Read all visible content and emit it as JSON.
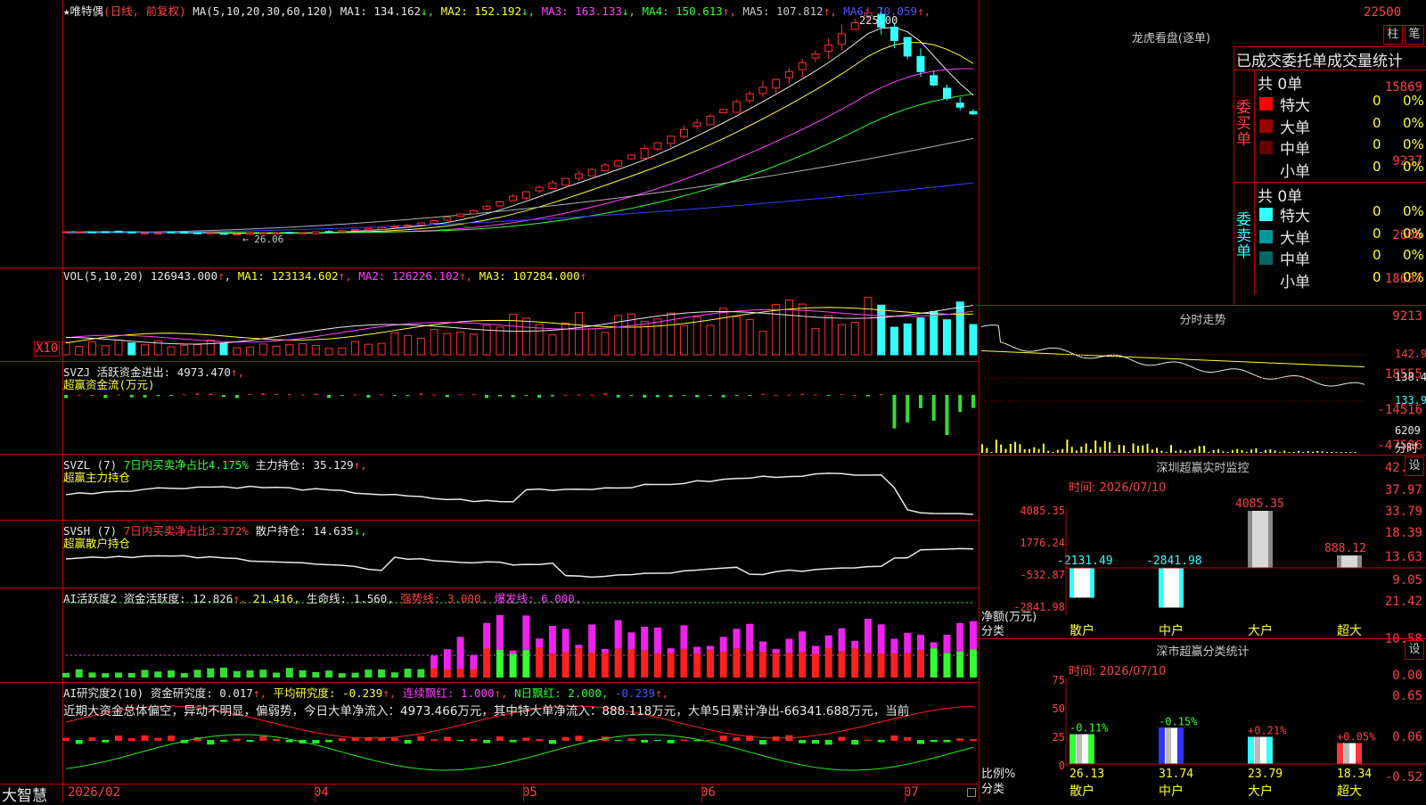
{
  "app": {
    "name": "大智慧"
  },
  "stock": {
    "star": "★",
    "name": "唯特偶",
    "period": "(日线, 前复权)"
  },
  "kline": {
    "ma_label": "MA(5,10,20,30,60,120)",
    "mas": [
      {
        "label": "MA1:",
        "value": "134.162",
        "arrow": "↓",
        "color": "#e8e8e8"
      },
      {
        "label": "MA2:",
        "value": "152.192",
        "arrow": "↓",
        "color": "#ffff33"
      },
      {
        "label": "MA3:",
        "value": "163.133",
        "arrow": "↓",
        "color": "#ff40ff"
      },
      {
        "label": "MA4:",
        "value": "150.613",
        "arrow": "↑",
        "color": "#33ff33"
      },
      {
        "label": "MA5:",
        "value": "107.812",
        "arrow": "↑",
        "color": "#c8c8c8"
      },
      {
        "label": "MA6:",
        "value": "70.059",
        "arrow": "↑",
        "color": "#5050ff"
      }
    ],
    "axis": [
      "22500",
      "15869",
      "9237",
      "2606"
    ],
    "high_marker": "225.00",
    "low_marker": "← 26.06"
  },
  "vol": {
    "label": "VOL(5,10,20)",
    "value": "126943.000",
    "arrow": "↑",
    "ma1": "MA1: 123134.602",
    "ma2": "MA2: 126226.102",
    "ma3": "MA3: 107284.000",
    "axis": [
      "18657",
      "9213"
    ],
    "unit": "X10"
  },
  "svzj": {
    "label": "SVZJ",
    "desc": "活跃资金进出:",
    "value": "4973.470",
    "arrow": "↑,",
    "sub": "超赢资金流(万元)",
    "axis": [
      "18555",
      "-14516",
      "-47586"
    ]
  },
  "svzl": {
    "label": "SVZL (7)",
    "desc1": "7日内买卖净占比4.175%",
    "desc2": "主力持仓:",
    "value": "35.129",
    "arrow": "↑,",
    "sub": "超赢主力持仓",
    "axis": [
      "42.15",
      "37.97",
      "33.79"
    ]
  },
  "svsh": {
    "label": "SVSH (7)",
    "desc1": "7日内买卖净占比3.372%",
    "desc2": "散户持仓:",
    "value": "14.635",
    "arrow": "↓,",
    "sub": "超赢散户持仓",
    "axis": [
      "18.39",
      "13.63",
      "9.05"
    ]
  },
  "ai1": {
    "label": "AI活跃度2",
    "a": "资金活跃度:",
    "av": "12.826",
    "aa": "↑,",
    "b": "21.416,",
    "c": "生命线:",
    "cv": "1.560,",
    "d": "强势线:",
    "dv": "3.000,",
    "e": "爆发线:",
    "ev": "6.000,",
    "axis": [
      "21.42",
      "10.58",
      "0.00"
    ]
  },
  "ai2": {
    "label": "AI研究度2(10)",
    "a": "资金研究度:",
    "av": "0.017",
    "aa": "↑,",
    "b": "平均研究度:",
    "bv": "-0.239",
    "ba": "↑,",
    "c": "连续飘红:",
    "cv": "1.000",
    "ca": "↑,",
    "d": "N日飘红:",
    "dv": "2.000,",
    "e": "-0.239",
    "ea": "↑,",
    "comment": "近期大资金总体偏空，异动不明显，偏弱势，今日大单净流入：4973.466万元，其中特大单净流入：888.118万元，大单5日累计净出-66341.688万元，当前",
    "axis": [
      "0.65",
      "0.06",
      "-0.52"
    ]
  },
  "xaxis": [
    "2026/02",
    "04",
    "05",
    "06",
    "07"
  ],
  "lhb": {
    "title": "龙虎看盘(逐单)",
    "btn1": "柱",
    "btn2": "笔",
    "subtitle": "已成交委托单成交量统计",
    "buy": {
      "side": "委买单",
      "total": "共 0单",
      "rows": [
        {
          "name": "特大",
          "v": "0",
          "p": "0%",
          "color": "#ff0000"
        },
        {
          "name": "大单",
          "v": "0",
          "p": "0%",
          "color": "#990000"
        },
        {
          "name": "中单",
          "v": "0",
          "p": "0%",
          "color": "#660000"
        },
        {
          "name": "小单",
          "v": "0",
          "p": "0%",
          "color": "#000000"
        }
      ]
    },
    "sell": {
      "side": "委卖单",
      "total": "共 0单",
      "rows": [
        {
          "name": "特大",
          "v": "0",
          "p": "0%",
          "color": "#33ffff"
        },
        {
          "name": "大单",
          "v": "0",
          "p": "0%",
          "color": "#009999"
        },
        {
          "name": "中单",
          "v": "0",
          "p": "0%",
          "color": "#006666"
        },
        {
          "name": "小单",
          "v": "0",
          "p": "0%",
          "color": "#000000"
        }
      ]
    }
  },
  "fenshi": {
    "title": "分时走势",
    "axis": [
      "142.9",
      "138.4",
      "133.9"
    ],
    "vol": "6209",
    "unit": "分时"
  },
  "monitor": {
    "title": "深圳超赢实时监控",
    "btn": "设",
    "time": "时间: 2026/07/10",
    "axis": [
      "4085.35",
      "1776.24",
      "-532.87",
      "-2841.98"
    ],
    "ylabel1": "净额(万元)",
    "ylabel2": "分类",
    "bars": [
      {
        "cat": "散户",
        "value": -2131.49,
        "label": "-2131.49"
      },
      {
        "cat": "中户",
        "value": -2841.98,
        "label": "-2841.98"
      },
      {
        "cat": "大户",
        "value": 4085.35,
        "label": "4085.35"
      },
      {
        "cat": "超大",
        "value": 888.12,
        "label": "888.12"
      }
    ]
  },
  "classify": {
    "title": "深市超赢分类统计",
    "btn": "设",
    "time": "时间: 2026/07/10",
    "axis": [
      "75",
      "50",
      "25",
      "0"
    ],
    "ylabel1": "比例%",
    "ylabel2": "分类",
    "bars": [
      {
        "cat": "散户",
        "value": 26.13,
        "label": "26.13",
        "chg": "-0.11%",
        "color": "#33ff33"
      },
      {
        "cat": "中户",
        "value": 31.74,
        "label": "31.74",
        "chg": "-0.15%",
        "color": "#3333ff"
      },
      {
        "cat": "大户",
        "value": 23.79,
        "label": "23.79",
        "chg": "+0.21%",
        "color": "#33ffff"
      },
      {
        "cat": "超大",
        "value": 18.34,
        "label": "18.34",
        "chg": "+0.05%",
        "color": "#ff3333"
      }
    ]
  },
  "chart_data": [
    {
      "type": "candlestick",
      "ylim": [
        2606,
        22500
      ],
      "ma_series": [
        "MA1",
        "MA2",
        "MA3",
        "MA4",
        "MA5",
        "MA6"
      ],
      "close_series": [
        28,
        28,
        28,
        28,
        28,
        27,
        27,
        27,
        27,
        27,
        27,
        27,
        26,
        26,
        27,
        27,
        27,
        27,
        27,
        28,
        28,
        29,
        30,
        31,
        32,
        33,
        34,
        36,
        38,
        41,
        44,
        47,
        51,
        55,
        60,
        64,
        68,
        72,
        76,
        80,
        84,
        88,
        92,
        97,
        103,
        108,
        114,
        120,
        126,
        132,
        138,
        145,
        152,
        158,
        165,
        172,
        180,
        188,
        196,
        206,
        216,
        225,
        212,
        200,
        186,
        172,
        160,
        148,
        140,
        134
      ]
    },
    {
      "type": "bar",
      "title": "VOL",
      "ylim": [
        0,
        18657
      ]
    },
    {
      "type": "bar",
      "title": "SVZJ",
      "ylim": [
        -47586,
        18555
      ]
    },
    {
      "type": "line",
      "title": "SVZL",
      "ylim": [
        33.79,
        42.15
      ]
    },
    {
      "type": "line",
      "title": "SVSH",
      "ylim": [
        9.05,
        18.39
      ]
    },
    {
      "type": "bar",
      "title": "AI活跃度2",
      "ylim": [
        0,
        21.42
      ]
    },
    {
      "type": "bar",
      "title": "AI研究度2(10)",
      "ylim": [
        -0.52,
        0.65
      ]
    },
    {
      "type": "bar",
      "title": "深圳超赢实时监控",
      "categories": [
        "散户",
        "中户",
        "大户",
        "超大"
      ],
      "values": [
        -2131.49,
        -2841.98,
        4085.35,
        888.12
      ],
      "ylim": [
        -2841.98,
        4085.35
      ]
    },
    {
      "type": "bar",
      "title": "深市超赢分类统计",
      "categories": [
        "散户",
        "中户",
        "大户",
        "超大"
      ],
      "values": [
        26.13,
        31.74,
        23.79,
        18.34
      ],
      "ylim": [
        0,
        75
      ]
    }
  ]
}
